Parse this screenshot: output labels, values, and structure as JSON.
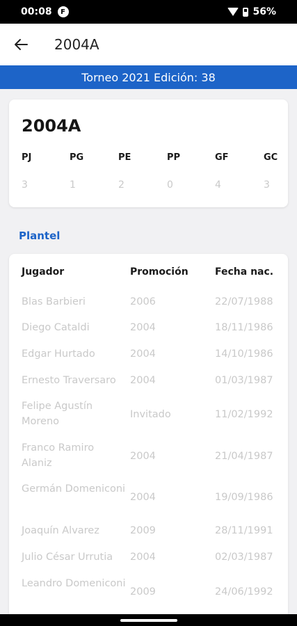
{
  "status": {
    "time": "00:08",
    "app_icon_letter": "F",
    "battery": "56%"
  },
  "app_bar": {
    "title": "2004A"
  },
  "banner": {
    "text": "Torneo 2021 Edición: 38"
  },
  "team": {
    "name": "2004A",
    "stats": [
      {
        "label": "PJ",
        "value": "3"
      },
      {
        "label": "PG",
        "value": "1"
      },
      {
        "label": "PE",
        "value": "2"
      },
      {
        "label": "PP",
        "value": "0"
      },
      {
        "label": "GF",
        "value": "4"
      },
      {
        "label": "GC",
        "value": "3"
      }
    ]
  },
  "section_title": "Plantel",
  "roster": {
    "headers": {
      "player": "Jugador",
      "promotion": "Promoción",
      "birth": "Fecha nac."
    },
    "rows": [
      {
        "player": "Blas Barbieri",
        "promotion": "2006",
        "birth": "22/07/1988"
      },
      {
        "player": "Diego Cataldi",
        "promotion": "2004",
        "birth": "18/11/1986"
      },
      {
        "player": "Edgar Hurtado",
        "promotion": "2004",
        "birth": "14/10/1986"
      },
      {
        "player": "Ernesto Traversaro",
        "promotion": "2004",
        "birth": "01/03/1987"
      },
      {
        "player": "Felipe Agustín Moreno",
        "promotion": "Invitado",
        "birth": "11/02/1992"
      },
      {
        "player": "Franco Ramiro Alaniz",
        "promotion": "2004",
        "birth": "21/04/1987"
      },
      {
        "player": "Germán Domeniconi",
        "promotion": "2004",
        "birth": "19/09/1986"
      },
      {
        "player": "Joaquín Alvarez",
        "promotion": "2009",
        "birth": "28/11/1991"
      },
      {
        "player": "Julio César Urrutia",
        "promotion": "2004",
        "birth": "02/03/1987"
      },
      {
        "player": "Leandro Domeniconi",
        "promotion": "2009",
        "birth": "24/06/1992"
      }
    ]
  },
  "colors": {
    "accent": "#1d64c8",
    "muted_text": "#c9c9c9"
  }
}
